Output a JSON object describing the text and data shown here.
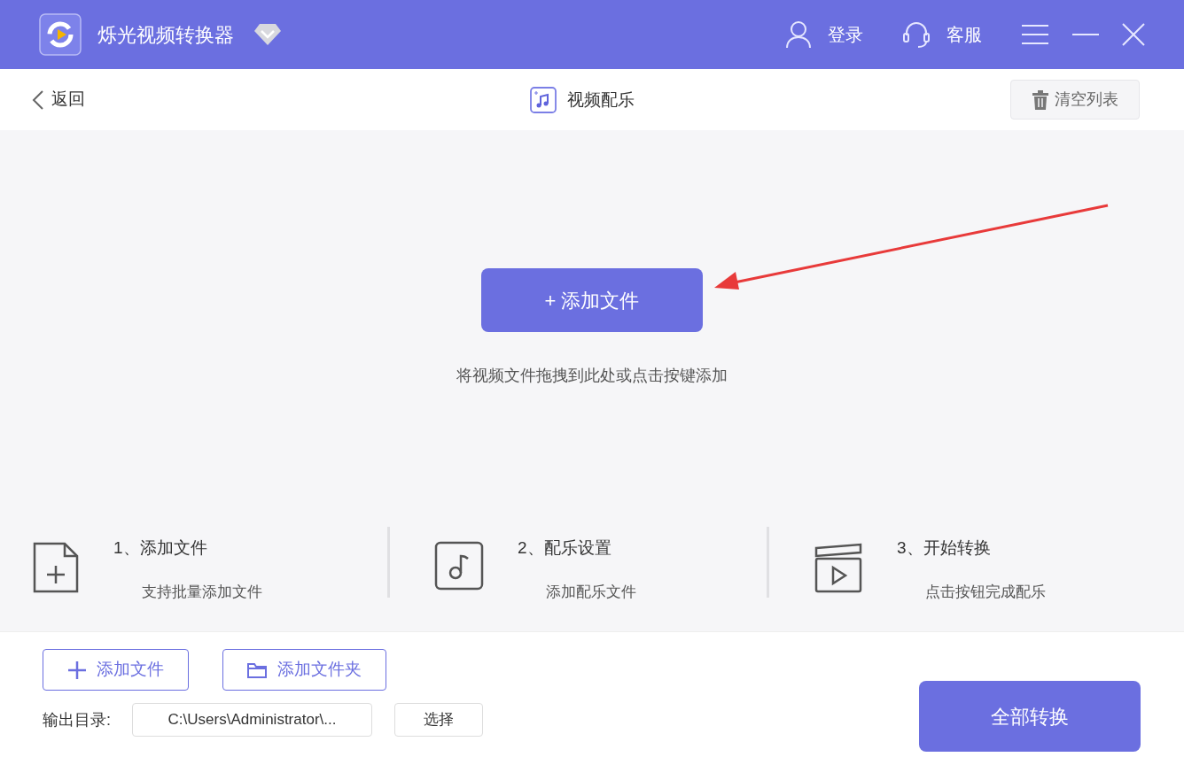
{
  "window": {
    "title": "烁光视频转换器"
  },
  "header_actions": [
    {
      "kind": "login",
      "label": "登录"
    },
    {
      "kind": "support",
      "label": "客服"
    }
  ],
  "toolbar": {
    "back": "返回",
    "title": "视频配乐",
    "clear": "清空列表"
  },
  "drop_zone": {
    "button": "+ 添加文件",
    "hint": "将视频文件拖拽到此处或点击按键添加"
  },
  "steps": [
    {
      "kind": "file",
      "title": "1、添加文件",
      "subtitle": "支持批量添加文件"
    },
    {
      "kind": "music",
      "title": "2、配乐设置",
      "subtitle": "添加配乐文件"
    },
    {
      "kind": "video",
      "title": "3、开始转换",
      "subtitle": "点击按钮完成配乐"
    }
  ],
  "footer": {
    "add_file": "添加文件",
    "add_folder": "添加文件夹",
    "output_label": "输出目录:",
    "output_path": "C:\\Users\\Administrator\\...",
    "choose": "选择",
    "convert_all": "全部转换"
  }
}
